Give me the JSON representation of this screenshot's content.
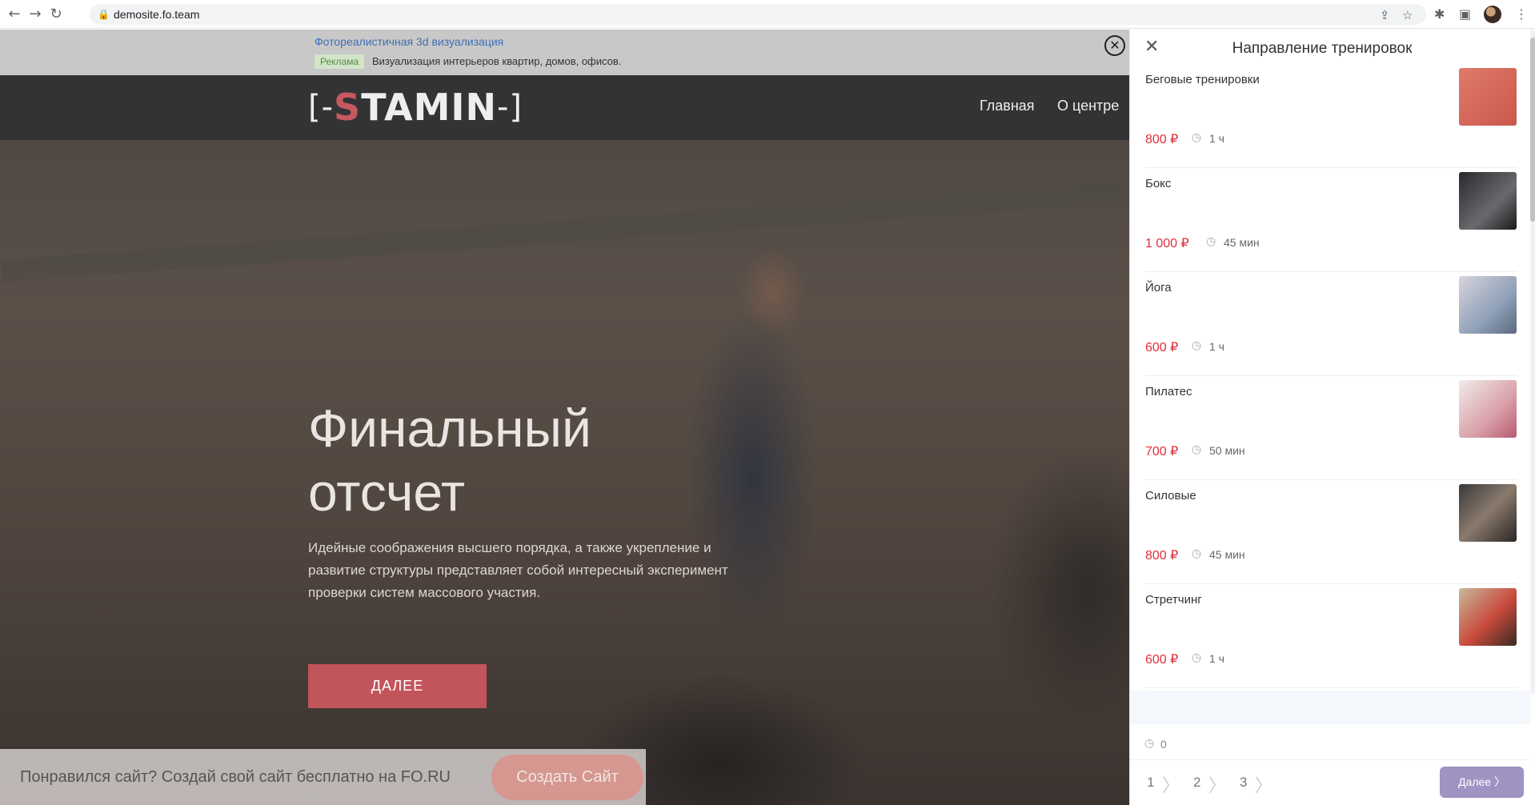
{
  "browser": {
    "back_icon": "←",
    "forward_icon": "→",
    "reload_icon": "↻",
    "lock_icon": "🔒",
    "url": "demosite.fo.team",
    "share_icon": "⇪",
    "star_icon": "☆",
    "extensions_icon": "✱",
    "sidepanel_icon": "▣",
    "menu_icon": "⋮"
  },
  "ad": {
    "title": "Фотореалистичная 3d визуализация",
    "badge": "Реклама",
    "description": "Визуализация интерьеров квартир, домов, офисов.",
    "close_icon": "✕"
  },
  "header": {
    "logo_left": "[-",
    "logo_s": "S",
    "logo_rest": "TAMIN",
    "logo_right": "-]",
    "menu": [
      "Главная",
      "О центре"
    ]
  },
  "hero": {
    "title_line1": "Финальный",
    "title_line2": "отсчет",
    "text": "Идейные соображения высшего порядка, а также укрепление и развитие структуры представляет собой интересный эксперимент проверки систем массового участия.",
    "button": "ДАЛЕЕ"
  },
  "promo": {
    "text": "Понравился сайт? Создай свой сайт бесплатно на FO.RU",
    "button": "Создать Сайт"
  },
  "panel": {
    "title": "Направление тренировок",
    "close_icon": "✕",
    "clock_icon": "◷",
    "services": [
      {
        "name": "Беговые тренировки",
        "price": "800 ₽",
        "duration": "1 ч"
      },
      {
        "name": "Бокс",
        "price": "1 000 ₽",
        "duration": "45 мин"
      },
      {
        "name": "Йога",
        "price": "600 ₽",
        "duration": "1 ч"
      },
      {
        "name": "Пилатес",
        "price": "700 ₽",
        "duration": "50 мин"
      },
      {
        "name": "Силовые",
        "price": "800 ₽",
        "duration": "45 мин"
      },
      {
        "name": "Стретчинг",
        "price": "600 ₽",
        "duration": "1 ч"
      }
    ],
    "total": "0",
    "steps": [
      "1",
      "2",
      "3"
    ],
    "chevron": "〉",
    "next_button": "Далее 〉"
  }
}
